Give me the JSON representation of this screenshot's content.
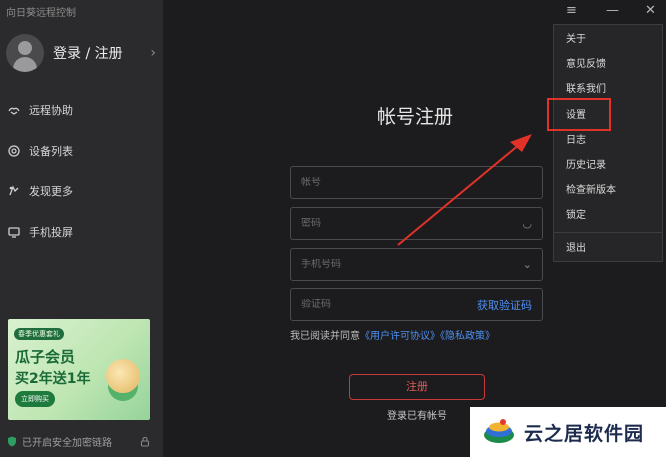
{
  "app": {
    "title": "向日葵远程控制"
  },
  "profile": {
    "login_label": "登录 / 注册"
  },
  "nav": [
    {
      "label": "远程协助",
      "icon": "remote-assist-icon"
    },
    {
      "label": "设备列表",
      "icon": "device-list-icon"
    },
    {
      "label": "发现更多",
      "icon": "discover-icon"
    },
    {
      "label": "手机投屏",
      "icon": "screen-cast-icon"
    }
  ],
  "promo": {
    "tag": "春季优惠套礼",
    "line1": "瓜子会员",
    "line2": "买2年送1年",
    "button": "立即购买"
  },
  "security": {
    "text": "已开启安全加密链路"
  },
  "register": {
    "title": "帐号注册",
    "account_placeholder": "帐号",
    "password_placeholder": "密码",
    "phone_placeholder": "手机号码",
    "code_placeholder": "验证码",
    "get_code": "获取验证码",
    "agree_prefix": "我已阅读并同意",
    "license_link": "《用户许可协议》",
    "privacy_link": "《隐私政策》",
    "submit": "注册",
    "has_account": "登录已有帐号"
  },
  "menu": {
    "items": [
      "关于",
      "意见反馈",
      "联系我们",
      "设置",
      "日志",
      "历史记录",
      "检查新版本",
      "锁定"
    ],
    "exit": "退出"
  },
  "watermark": {
    "text": "云之居软件园"
  },
  "colors": {
    "accent_red": "#e23128",
    "link_blue": "#4e8ff2"
  }
}
